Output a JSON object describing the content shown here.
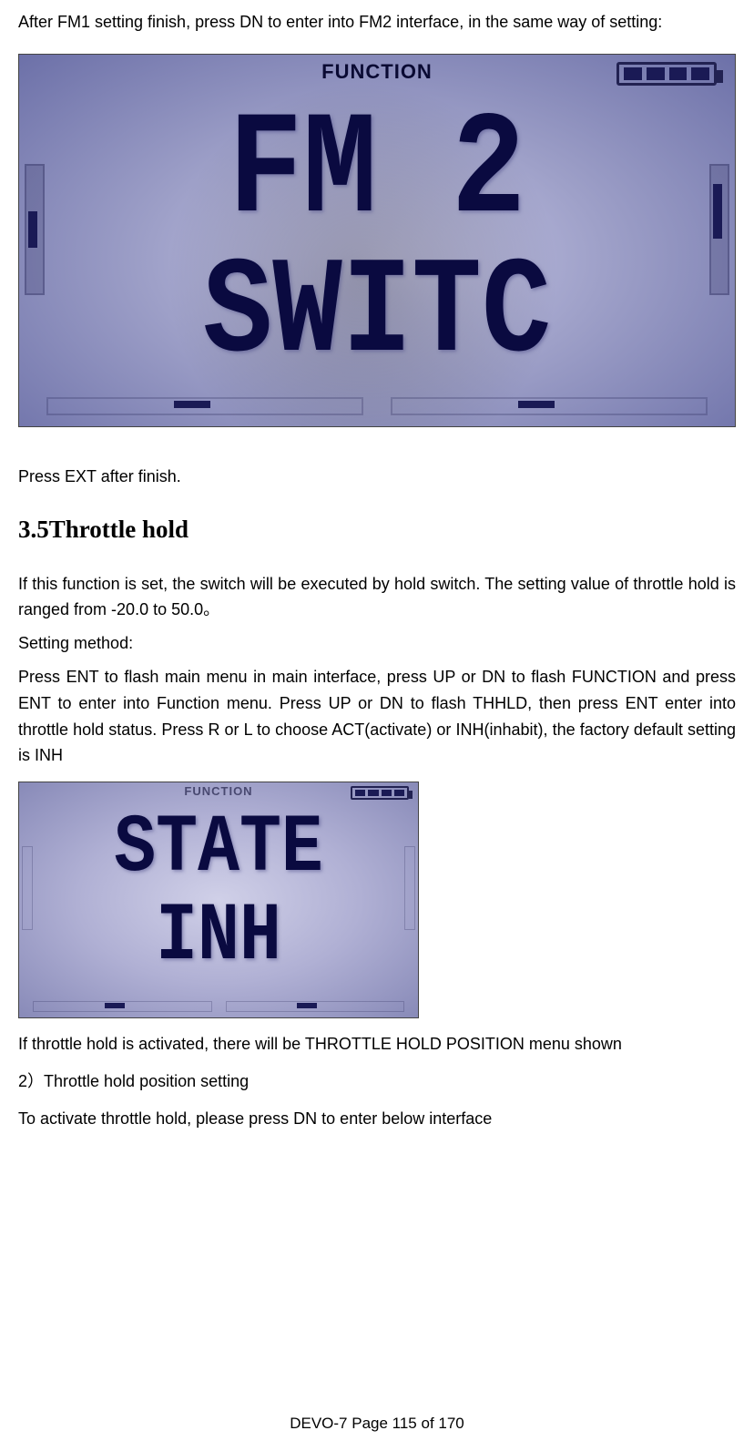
{
  "intro": "After FM1 setting finish, press DN to enter into FM2 interface, in the same way of setting:",
  "fig1": {
    "top_label": "FUNCTION",
    "row1": "FM 2",
    "row2": "SWITC"
  },
  "after_fig1": "Press EXT after finish.",
  "section_title": "3.5Throttle hold",
  "para1": "If this function is set, the switch will be executed by hold switch. The setting value of throttle hold is ranged from -20.0 to 50.0。",
  "para2": "Setting method:",
  "para3": "Press ENT to flash main menu in main interface, press UP or DN to flash FUNCTION and press ENT to enter into Function menu. Press UP or DN to flash THHLD, then press ENT enter into throttle hold status. Press R or L to choose ACT(activate) or INH(inhabit), the factory default setting is INH",
  "fig2": {
    "top_label": "FUNCTION",
    "row1": "STATE",
    "row2": "INH"
  },
  "para4": "If throttle hold is activated, there will be THROTTLE HOLD POSITION menu shown",
  "para5": "2）Throttle hold position setting",
  "para6": "To activate throttle hold, please press DN to enter below interface",
  "footer": "DEVO-7     Page 115 of 170"
}
